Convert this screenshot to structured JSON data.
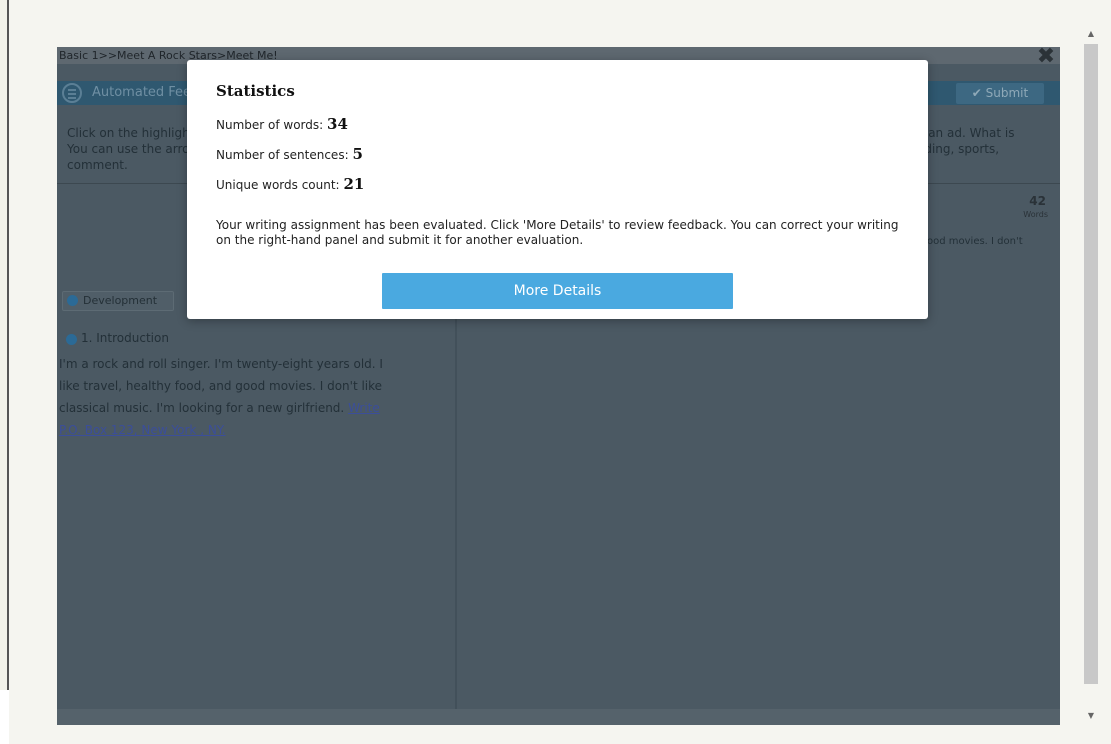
{
  "breadcrumb": "Basic 1>>Meet A Rock Stars>Meet Me!",
  "header": {
    "title": "Automated Feedback",
    "submit_label": "Submit",
    "close_label": "✖"
  },
  "instructions": {
    "left_line1": "Click on the highlighted text to see the feedback.",
    "left_line2": "You can use the arrow buttons to navigate through the",
    "left_line3": "comment.",
    "right_line1": "e an ad. What is",
    "right_line2": "ading, sports,"
  },
  "right_panel": {
    "word_count": "42",
    "word_count_label": "Words",
    "essay_snippet": "ood movies. I don't"
  },
  "left_panel": {
    "tag": "Development",
    "section_heading": "1. Introduction",
    "essay_line1": "I'm a rock and roll singer. I'm twenty-eight years old. I",
    "essay_line2": "like travel, healthy food, and good movies. I don't like",
    "essay_line3_plain": "classical music. I'm looking for a new girlfriend. ",
    "essay_line3_link": "Write",
    "essay_line4_link": "P.O. Box 123, New York , NY."
  },
  "modal": {
    "title": "Statistics",
    "words_label": "Number of words:",
    "words_value": "34",
    "sentences_label": "Number of sentences:",
    "sentences_value": "5",
    "unique_label": "Unique words count:",
    "unique_value": "21",
    "message": "Your writing assignment has been evaluated. Click 'More Details' to review feedback. You can correct your writing on the right-hand panel and submit it for another evaluation.",
    "button_label": "More Details"
  },
  "colors": {
    "accent": "#4aa9e0",
    "overlay_panel": "#4b5963",
    "title_bar": "#2f5870"
  }
}
